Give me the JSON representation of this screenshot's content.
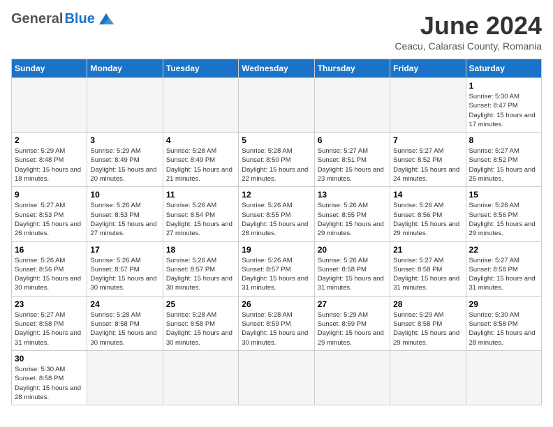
{
  "header": {
    "logo_general": "General",
    "logo_blue": "Blue",
    "month_title": "June 2024",
    "subtitle": "Ceacu, Calarasi County, Romania"
  },
  "days_of_week": [
    "Sunday",
    "Monday",
    "Tuesday",
    "Wednesday",
    "Thursday",
    "Friday",
    "Saturday"
  ],
  "weeks": [
    [
      {
        "day": "",
        "info": ""
      },
      {
        "day": "",
        "info": ""
      },
      {
        "day": "",
        "info": ""
      },
      {
        "day": "",
        "info": ""
      },
      {
        "day": "",
        "info": ""
      },
      {
        "day": "",
        "info": ""
      },
      {
        "day": "1",
        "info": "Sunrise: 5:30 AM\nSunset: 8:47 PM\nDaylight: 15 hours and 17 minutes."
      }
    ],
    [
      {
        "day": "2",
        "info": "Sunrise: 5:29 AM\nSunset: 8:48 PM\nDaylight: 15 hours and 18 minutes."
      },
      {
        "day": "3",
        "info": "Sunrise: 5:29 AM\nSunset: 8:49 PM\nDaylight: 15 hours and 20 minutes."
      },
      {
        "day": "4",
        "info": "Sunrise: 5:28 AM\nSunset: 8:49 PM\nDaylight: 15 hours and 21 minutes."
      },
      {
        "day": "5",
        "info": "Sunrise: 5:28 AM\nSunset: 8:50 PM\nDaylight: 15 hours and 22 minutes."
      },
      {
        "day": "6",
        "info": "Sunrise: 5:27 AM\nSunset: 8:51 PM\nDaylight: 15 hours and 23 minutes."
      },
      {
        "day": "7",
        "info": "Sunrise: 5:27 AM\nSunset: 8:52 PM\nDaylight: 15 hours and 24 minutes."
      },
      {
        "day": "8",
        "info": "Sunrise: 5:27 AM\nSunset: 8:52 PM\nDaylight: 15 hours and 25 minutes."
      }
    ],
    [
      {
        "day": "9",
        "info": "Sunrise: 5:27 AM\nSunset: 8:53 PM\nDaylight: 15 hours and 26 minutes."
      },
      {
        "day": "10",
        "info": "Sunrise: 5:26 AM\nSunset: 8:53 PM\nDaylight: 15 hours and 27 minutes."
      },
      {
        "day": "11",
        "info": "Sunrise: 5:26 AM\nSunset: 8:54 PM\nDaylight: 15 hours and 27 minutes."
      },
      {
        "day": "12",
        "info": "Sunrise: 5:26 AM\nSunset: 8:55 PM\nDaylight: 15 hours and 28 minutes."
      },
      {
        "day": "13",
        "info": "Sunrise: 5:26 AM\nSunset: 8:55 PM\nDaylight: 15 hours and 29 minutes."
      },
      {
        "day": "14",
        "info": "Sunrise: 5:26 AM\nSunset: 8:56 PM\nDaylight: 15 hours and 29 minutes."
      },
      {
        "day": "15",
        "info": "Sunrise: 5:26 AM\nSunset: 8:56 PM\nDaylight: 15 hours and 29 minutes."
      }
    ],
    [
      {
        "day": "16",
        "info": "Sunrise: 5:26 AM\nSunset: 8:56 PM\nDaylight: 15 hours and 30 minutes."
      },
      {
        "day": "17",
        "info": "Sunrise: 5:26 AM\nSunset: 8:57 PM\nDaylight: 15 hours and 30 minutes."
      },
      {
        "day": "18",
        "info": "Sunrise: 5:26 AM\nSunset: 8:57 PM\nDaylight: 15 hours and 30 minutes."
      },
      {
        "day": "19",
        "info": "Sunrise: 5:26 AM\nSunset: 8:57 PM\nDaylight: 15 hours and 31 minutes."
      },
      {
        "day": "20",
        "info": "Sunrise: 5:26 AM\nSunset: 8:58 PM\nDaylight: 15 hours and 31 minutes."
      },
      {
        "day": "21",
        "info": "Sunrise: 5:27 AM\nSunset: 8:58 PM\nDaylight: 15 hours and 31 minutes."
      },
      {
        "day": "22",
        "info": "Sunrise: 5:27 AM\nSunset: 8:58 PM\nDaylight: 15 hours and 31 minutes."
      }
    ],
    [
      {
        "day": "23",
        "info": "Sunrise: 5:27 AM\nSunset: 8:58 PM\nDaylight: 15 hours and 31 minutes."
      },
      {
        "day": "24",
        "info": "Sunrise: 5:28 AM\nSunset: 8:58 PM\nDaylight: 15 hours and 30 minutes."
      },
      {
        "day": "25",
        "info": "Sunrise: 5:28 AM\nSunset: 8:58 PM\nDaylight: 15 hours and 30 minutes."
      },
      {
        "day": "26",
        "info": "Sunrise: 5:28 AM\nSunset: 8:59 PM\nDaylight: 15 hours and 30 minutes."
      },
      {
        "day": "27",
        "info": "Sunrise: 5:29 AM\nSunset: 8:59 PM\nDaylight: 15 hours and 29 minutes."
      },
      {
        "day": "28",
        "info": "Sunrise: 5:29 AM\nSunset: 8:58 PM\nDaylight: 15 hours and 29 minutes."
      },
      {
        "day": "29",
        "info": "Sunrise: 5:30 AM\nSunset: 8:58 PM\nDaylight: 15 hours and 28 minutes."
      }
    ],
    [
      {
        "day": "30",
        "info": "Sunrise: 5:30 AM\nSunset: 8:58 PM\nDaylight: 15 hours and 28 minutes."
      },
      {
        "day": "",
        "info": ""
      },
      {
        "day": "",
        "info": ""
      },
      {
        "day": "",
        "info": ""
      },
      {
        "day": "",
        "info": ""
      },
      {
        "day": "",
        "info": ""
      },
      {
        "day": "",
        "info": ""
      }
    ]
  ]
}
